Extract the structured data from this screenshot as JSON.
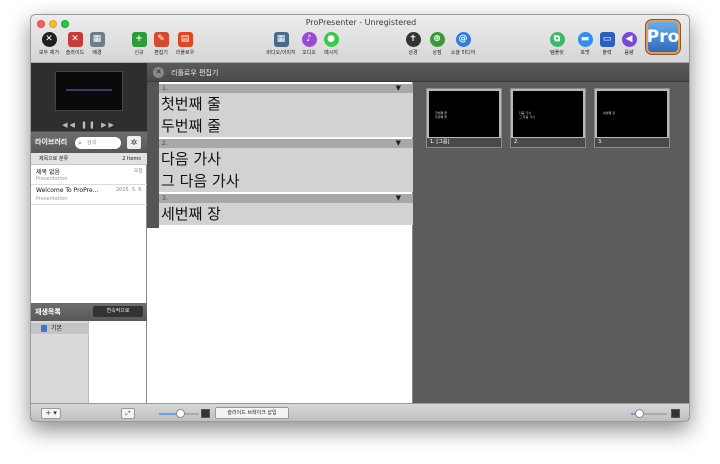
{
  "window": {
    "title": "ProPresenter - Unregistered"
  },
  "toolbar": {
    "clear_all": "모두 제거",
    "slide": "슬라이드",
    "background": "배경",
    "new": "신규",
    "edit": "편집기",
    "reflow": "리플로우",
    "video_image": "비디오/이미지",
    "audio": "오디오",
    "message": "메시지",
    "bible": "성경",
    "store": "상점",
    "social_media": "소셜 미디어",
    "template": "템플릿",
    "format": "포맷",
    "output": "출력",
    "volume": "음량",
    "logo": "Pro"
  },
  "preview": {
    "controls": "◀◀ ❚❚ ▶▶"
  },
  "library": {
    "title": "라이브러리",
    "search_placeholder": "검색",
    "sort_label": "제목으로 분류",
    "count": "2 Items",
    "items": [
      {
        "name": "제목 없음",
        "date": "오늘",
        "type": "Presentation"
      },
      {
        "name": "Welcome To ProPre...",
        "date": "2015. 5. 6.",
        "type": "Presentation"
      }
    ]
  },
  "playlist": {
    "title": "재생목록",
    "continuous_button": "연속적으로",
    "items": [
      {
        "name": "기본"
      }
    ]
  },
  "editor": {
    "title": "리플로우 편집기",
    "groups": [
      {
        "number": "1.",
        "lines": [
          "첫번째 줄",
          "두번째 줄"
        ]
      },
      {
        "number": "2.",
        "lines": [
          "다음 가사",
          "그 다음 가사"
        ]
      },
      {
        "number": "3.",
        "lines": [
          "세번째 장"
        ]
      }
    ]
  },
  "slides": [
    {
      "caption": "1. [그룹]",
      "text": [
        "첫번째 줄",
        "두번째 줄"
      ]
    },
    {
      "caption": "2.",
      "text": [
        "다음 가사",
        "그 다음 가사"
      ]
    },
    {
      "caption": "3.",
      "text": [
        "세번째 장"
      ]
    }
  ],
  "bottom_bar": {
    "plus": "+ ▾",
    "expand": "⤢",
    "insert_break": "슬라이드 브레이크 삽입"
  },
  "colors": {
    "new_green": "#2e9b3a",
    "edit_red": "#d8482c",
    "reflow_red": "#e2451f",
    "audio_purple": "#9a4ad6",
    "message_green": "#3ac94a",
    "bible_dark": "#333333",
    "store_green": "#3a9a3a",
    "social_blue": "#2f7fe0",
    "template_green": "#3bb86a",
    "format_blue": "#2f8ef0",
    "output_blue": "#2a5fc0",
    "volume_purple": "#7a4ad6"
  }
}
